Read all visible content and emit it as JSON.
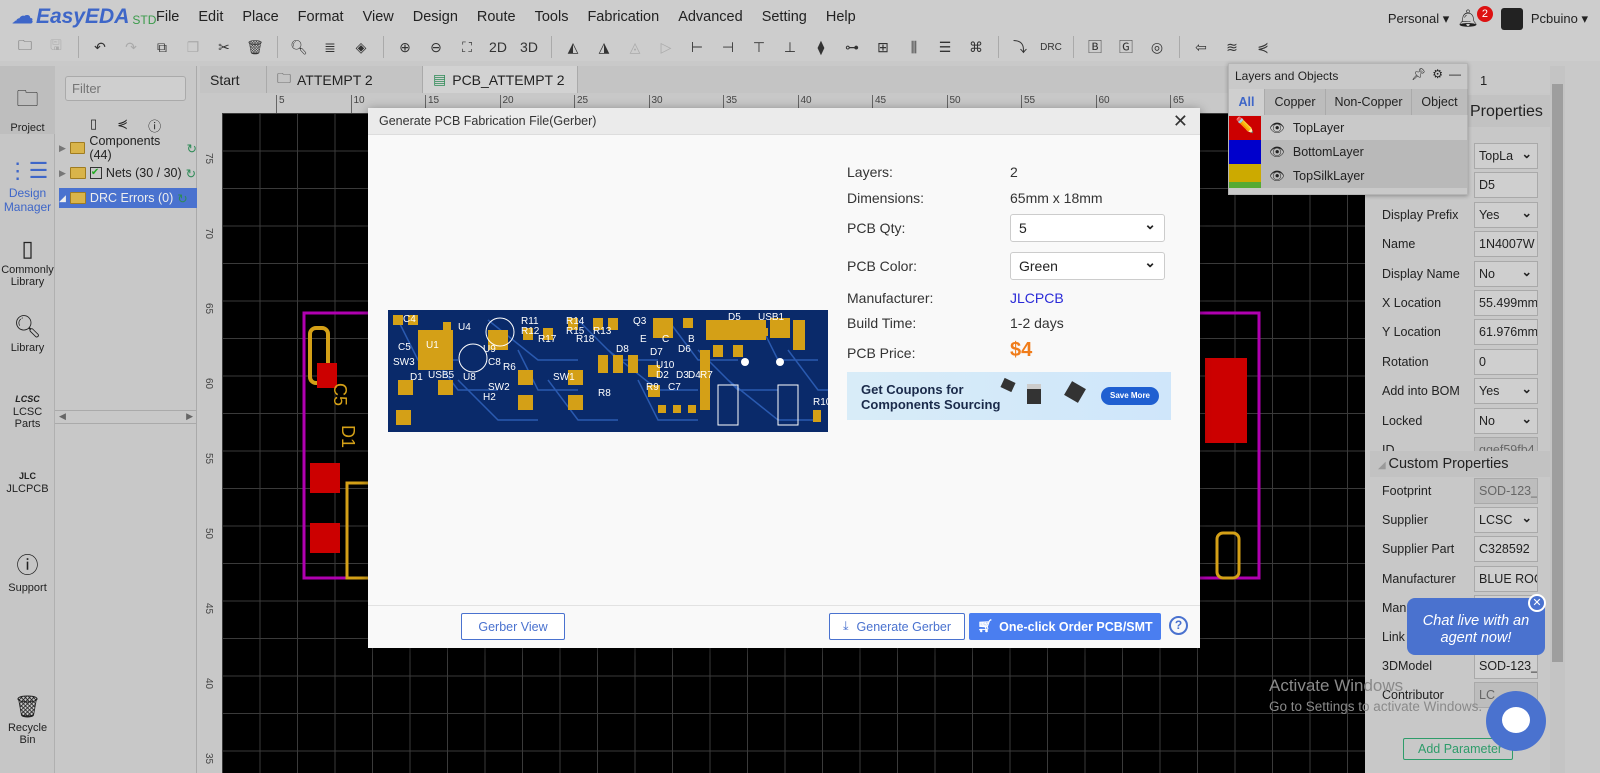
{
  "app": {
    "logo": "EasyEDA",
    "edition": "STD"
  },
  "menu": [
    "File",
    "Edit",
    "Place",
    "Format",
    "View",
    "Design",
    "Route",
    "Tools",
    "Fabrication",
    "Advanced",
    "Setting",
    "Help"
  ],
  "toolbar": {
    "view_2d": "2D",
    "view_3d": "3D",
    "drc": "DRC"
  },
  "user": {
    "workspace": "Personal",
    "notifications": "2",
    "name": "Pcbuino"
  },
  "leftnav": [
    "Project",
    "Design Manager",
    "Commonly Library",
    "Library",
    "LCSC Parts",
    "JLCPCB",
    "Support",
    "Recycle Bin"
  ],
  "design_manager": {
    "filter_placeholder": "Filter",
    "items": [
      {
        "label": "Components (44)"
      },
      {
        "label": "Nets (30 / 30)"
      },
      {
        "label": "DRC Errors (0)"
      }
    ]
  },
  "tabs": [
    "Start",
    "ATTEMPT 2",
    "PCB_ATTEMPT 2"
  ],
  "ruler": {
    "top": [
      "5",
      "10",
      "15",
      "20",
      "25",
      "30",
      "35",
      "40",
      "45",
      "50",
      "55",
      "60",
      "65"
    ],
    "left": [
      "75",
      "70",
      "65",
      "60",
      "55",
      "50",
      "45",
      "40",
      "35"
    ]
  },
  "layers_panel": {
    "title": "Layers and Objects",
    "tabs": [
      "All",
      "Copper",
      "Non-Copper",
      "Object"
    ],
    "active_tab": "All",
    "layers": [
      {
        "name": "TopLayer",
        "color": "#cc0000"
      },
      {
        "name": "BottomLayer",
        "color": "#0000cc"
      },
      {
        "name": "TopSilkLayer",
        "color": "#ccaa00"
      }
    ]
  },
  "properties": {
    "page_num": "1",
    "title": "Properties",
    "rows": [
      {
        "label": "",
        "value": "TopLa",
        "type": "select"
      },
      {
        "label": "",
        "value": "D5",
        "type": "input"
      },
      {
        "label": "Display Prefix",
        "value": "Yes",
        "type": "select"
      },
      {
        "label": "Name",
        "value": "1N4007W",
        "type": "input"
      },
      {
        "label": "Display Name",
        "value": "No",
        "type": "select"
      },
      {
        "label": "X Location",
        "value": "55.499mm",
        "type": "input"
      },
      {
        "label": "Y Location",
        "value": "61.976mm",
        "type": "input"
      },
      {
        "label": "Rotation",
        "value": "0",
        "type": "input"
      },
      {
        "label": "Add into BOM",
        "value": "Yes",
        "type": "select"
      },
      {
        "label": "Locked",
        "value": "No",
        "type": "select"
      },
      {
        "label": "ID",
        "value": "ggef59fb4",
        "type": "disabled"
      }
    ],
    "custom_title": "Custom Properties",
    "custom_rows": [
      {
        "label": "Footprint",
        "value": "SOD-123_",
        "type": "disabled"
      },
      {
        "label": "Supplier",
        "value": "LCSC",
        "type": "select"
      },
      {
        "label": "Supplier Part",
        "value": "C328592",
        "type": "input"
      },
      {
        "label": "Manufacturer",
        "value": "BLUE ROC",
        "type": "input"
      },
      {
        "label": "Manu",
        "value": "",
        "type": "input"
      },
      {
        "label": "Link",
        "value": "",
        "type": "input"
      },
      {
        "label": "3DModel",
        "value": "SOD-123_",
        "type": "input"
      },
      {
        "label": "Contributor",
        "value": "LC",
        "type": "disabled"
      }
    ],
    "add_param": "Add Parameter"
  },
  "dialog": {
    "title": "Generate PCB Fabrication File(Gerber)",
    "layers_label": "Layers:",
    "layers": "2",
    "dimensions_label": "Dimensions:",
    "dimensions": "65mm x 18mm",
    "qty_label": "PCB Qty:",
    "qty": "5",
    "color_label": "PCB Color:",
    "color": "Green",
    "manufacturer_label": "Manufacturer:",
    "manufacturer": "JLCPCB",
    "build_label": "Build Time:",
    "build": "1-2 days",
    "price_label": "PCB Price:",
    "price": "$4",
    "banner_line1": "Get Coupons for",
    "banner_line2": "Components Sourcing",
    "banner_button": "Save More",
    "gerber_view": "Gerber View",
    "generate": "Generate Gerber",
    "order": "One-click Order PCB/SMT",
    "pcb_labels": [
      "C4",
      "U1",
      "U4",
      "C5",
      "D1",
      "U9",
      "U8",
      "C8",
      "SW2",
      "USB5",
      "H2",
      "R11",
      "R12",
      "R14",
      "R15",
      "R13",
      "R17",
      "R18",
      "SW1",
      "Q3",
      "E",
      "C",
      "B",
      "D5",
      "USB1",
      "D8",
      "D7",
      "D6",
      "U10",
      "D2",
      "D3",
      "D4",
      "R7",
      "R8",
      "R9",
      "R10",
      "SW3",
      "R6",
      "C7"
    ]
  },
  "chat": {
    "bubble": "Chat live with an agent now!"
  },
  "watermark": {
    "line1": "Activate Windows",
    "line2": "Go to Settings to activate Windows."
  },
  "colors": {
    "accent": "#4a72cf",
    "price": "#f07c1a",
    "link": "#2a2ad8",
    "board_outline": "#b000b0",
    "pcb_blue": "#0a2a6a",
    "pad": "#d4a017"
  }
}
